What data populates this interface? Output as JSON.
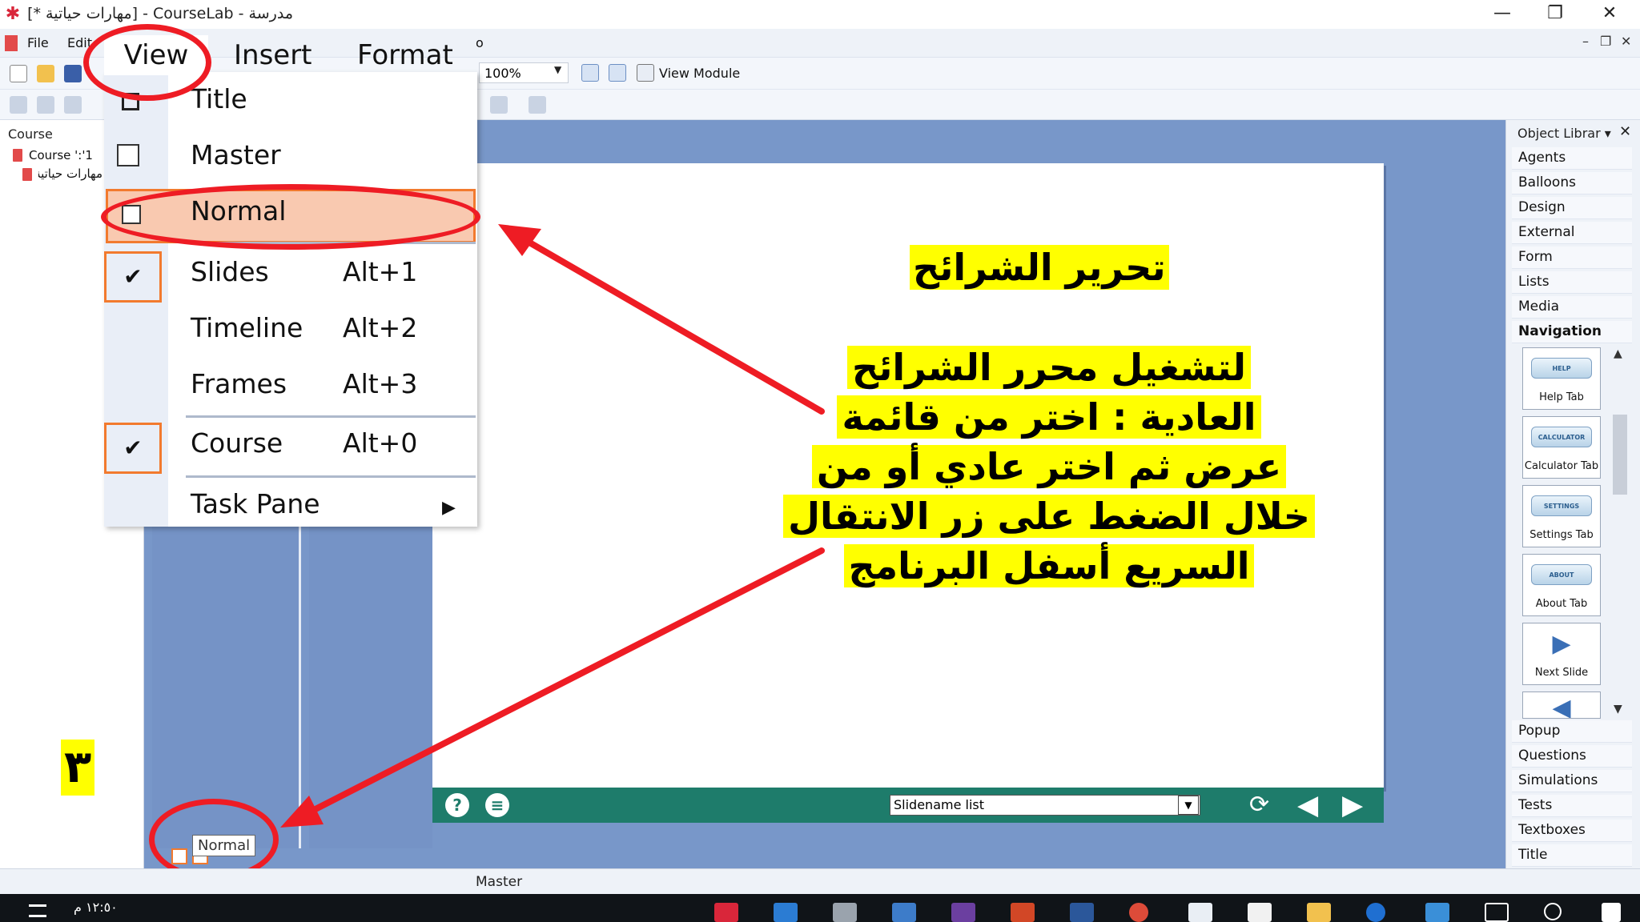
{
  "window": {
    "title": "مدرسة - CourseLab - [مهارات حياتية *]",
    "minimize": "—",
    "maximize": "❐",
    "close": "✕"
  },
  "menubar": {
    "file": "File",
    "edit": "Edit",
    "view": "View",
    "insert": "Insert",
    "format": "Format",
    "tools_fragment": "o"
  },
  "toolbar": {
    "zoom": "100%",
    "view_module": "View Module"
  },
  "course_pane": {
    "header": "Course",
    "items": [
      {
        "label": "Course ':'1"
      },
      {
        "label": "مهارات حياتية"
      }
    ]
  },
  "view_menu": {
    "items": [
      {
        "label": "Title",
        "accel": "",
        "checked": false
      },
      {
        "label": "Master",
        "accel": "",
        "checked": false
      },
      {
        "label": "Normal",
        "accel": "",
        "checked": false,
        "highlighted": true
      },
      {
        "label": "Slides",
        "accel": "Alt+1",
        "checked": true
      },
      {
        "label": "Timeline",
        "accel": "Alt+2",
        "checked": false
      },
      {
        "label": "Frames",
        "accel": "Alt+3",
        "checked": false
      },
      {
        "label": "Course",
        "accel": "Alt+0",
        "checked": true
      },
      {
        "label": "Task Pane",
        "accel": "",
        "checked": false,
        "submenu": true
      }
    ],
    "check_glyph": "✔",
    "submenu_glyph": "▶"
  },
  "slide": {
    "title": "تحرير الشرائح",
    "body_lines": [
      "لتشغيل محرر الشرائح",
      "العادية : اختر من قائمة",
      "عرض ثم اختر عادي أو من",
      "خلال الضغط على زر الانتقال",
      "السريع أسفل البرنامج"
    ]
  },
  "player": {
    "help_glyph": "?",
    "menu_glyph": "≡",
    "slidename_list": "Slidename list",
    "reload_glyph": "⟳",
    "prev_glyph": "◀",
    "next_glyph": "▶"
  },
  "object_library": {
    "title": "Object Librar",
    "close": "✕",
    "categories_top": [
      "Agents",
      "Balloons",
      "Design",
      "External",
      "Form",
      "Lists",
      "Media",
      "Navigation"
    ],
    "tiles": [
      {
        "pill": "HELP",
        "label": "Help Tab"
      },
      {
        "pill": "CALCULATOR",
        "label": "Calculator Tab"
      },
      {
        "pill": "SETTINGS",
        "label": "Settings Tab"
      },
      {
        "pill": "ABOUT",
        "label": "About Tab"
      },
      {
        "pill": "",
        "label": "Next Slide"
      }
    ],
    "categories_bottom": [
      "Popup",
      "Questions",
      "Simulations",
      "Tests",
      "Textboxes",
      "Title"
    ]
  },
  "annotation": {
    "step_number": "٣"
  },
  "status": {
    "text": "Master",
    "tooltip": "Normal"
  },
  "taskbar": {
    "clock": "١٢:٥٠ م"
  },
  "colors": {
    "annotation_red": "#ee1c24",
    "highlight_yellow": "#ffff00",
    "workspace_blue": "#7897c9",
    "player_teal": "#1e7c6b",
    "menu_orange": "#f27a2e"
  }
}
